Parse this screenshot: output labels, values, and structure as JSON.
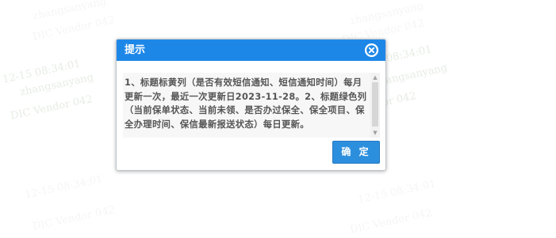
{
  "watermark": {
    "timestamp": "12-15 08:34:01",
    "user": "zhangsanyang",
    "vendor": "DIC Vendor 042"
  },
  "dialog": {
    "title": "提示",
    "message": "1、标题标黄列（是否有效短信通知、短信通知时间）每月更新一次，最近一次更新日2023-11-28。2、标题绿色列（当前保单状态、当前未领、是否办过保全、保全项目、保全办理时间、保信最新报送状态）每日更新。",
    "ok_label": "确 定",
    "close_icon": "close-icon",
    "scroll_up_icon": "▲",
    "scroll_down_icon": "▼"
  },
  "colors": {
    "header_bg": "#1d87e8",
    "ok_button_bg": "#2c8fde",
    "watermark": "#e4ebe0"
  }
}
